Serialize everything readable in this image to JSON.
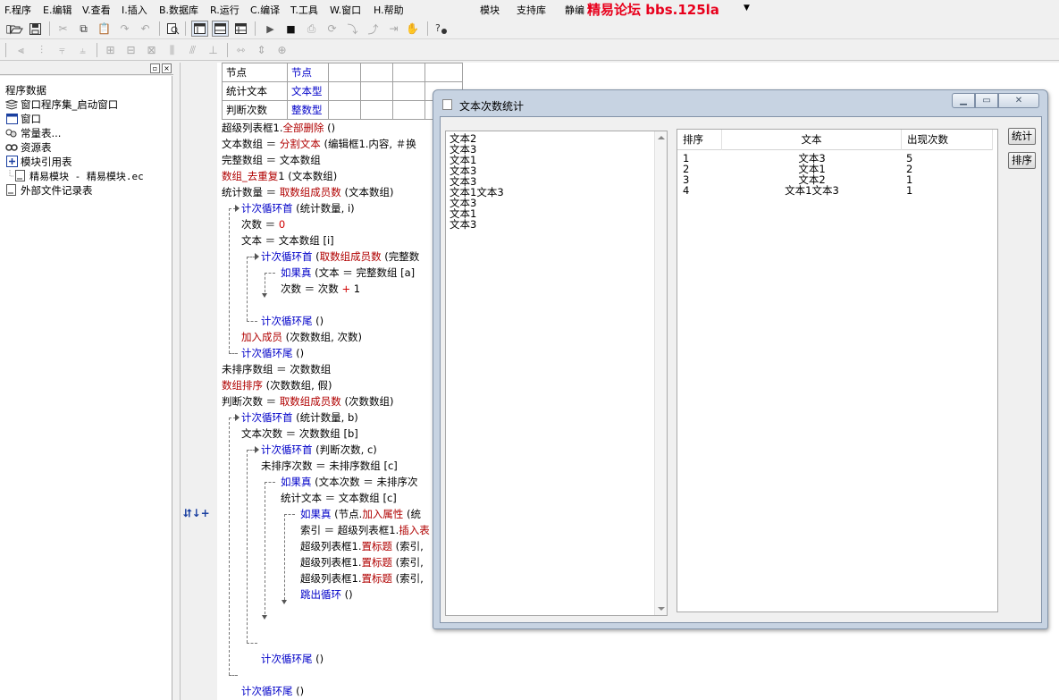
{
  "menubar": {
    "items": [
      "F.程序",
      "E.编辑",
      "V.查看",
      "I.插入",
      "B.数据库",
      "R.运行",
      "C.编译",
      "T.工具",
      "W.窗口",
      "H.帮助"
    ],
    "extra": [
      "模块",
      "支持库",
      "静编"
    ],
    "watermark": "精易论坛 bbs.125la"
  },
  "toolbar": {
    "icons": [
      "open-icon",
      "save-icon",
      "cut-icon",
      "copy-icon",
      "paste-icon",
      "redo-icon",
      "undo-icon",
      "find-icon",
      "layout-1-icon",
      "layout-2-icon",
      "layout-3-icon",
      "run-icon",
      "stop-icon",
      "step-icon",
      "step-into-icon",
      "step-over-icon",
      "step-out-icon",
      "run-to-icon",
      "hand-icon",
      "help-icon"
    ]
  },
  "left_panel": {
    "tree": [
      {
        "label": "程序数据",
        "icon": "",
        "indent": 0
      },
      {
        "label": "窗口程序集_启动窗口",
        "icon": "assembly-icon",
        "indent": 0
      },
      {
        "label": "窗口",
        "icon": "window-icon",
        "indent": 0
      },
      {
        "label": "常量表...",
        "icon": "constant-icon",
        "indent": 0
      },
      {
        "label": "资源表",
        "icon": "resource-icon",
        "indent": 0
      },
      {
        "label": "模块引用表",
        "icon": "module-icon",
        "indent": 0
      },
      {
        "label": "精易模块 - 精易模块.ec",
        "icon": "file-icon",
        "indent": 1
      },
      {
        "label": "外部文件记录表",
        "icon": "file-icon",
        "indent": 0
      }
    ]
  },
  "gutter": {
    "icons": "⮃↓+"
  },
  "editor": {
    "var_table": [
      [
        "节点",
        "节点"
      ],
      [
        "统计文本",
        "文本型"
      ],
      [
        "判断次数",
        "整数型"
      ]
    ],
    "lines": [
      {
        "indent": 0,
        "parts": [
          [
            "超级列表框1.",
            ""
          ],
          [
            "全部删除",
            "r"
          ],
          [
            " ()",
            ""
          ]
        ]
      },
      {
        "indent": 0,
        "parts": [
          [
            "文本数组 ＝ ",
            ""
          ],
          [
            "分割文本",
            "r"
          ],
          [
            " (编辑框1.内容, ＃换",
            ""
          ]
        ]
      },
      {
        "indent": 0,
        "parts": [
          [
            "完整数组 ＝ 文本数组",
            ""
          ]
        ]
      },
      {
        "indent": 0,
        "parts": [
          [
            "数组_去重复",
            "r"
          ],
          [
            "1 (文本数组)",
            ""
          ]
        ]
      },
      {
        "indent": 0,
        "parts": [
          [
            "统计数量 ＝ ",
            ""
          ],
          [
            "取数组成员数",
            "r"
          ],
          [
            " (文本数组)",
            ""
          ]
        ]
      },
      {
        "indent": 1,
        "parts": [
          [
            "计次循环首",
            "b"
          ],
          [
            " (统计数量, i)",
            ""
          ]
        ]
      },
      {
        "indent": 1,
        "parts": [
          [
            "次数 ＝ ",
            ""
          ],
          [
            "0",
            "n"
          ]
        ]
      },
      {
        "indent": 1,
        "parts": [
          [
            "文本 ＝ 文本数组 [i]",
            ""
          ]
        ]
      },
      {
        "indent": 2,
        "parts": [
          [
            "计次循环首",
            "b"
          ],
          [
            " (",
            ""
          ],
          [
            "取数组成员数",
            "r"
          ],
          [
            " (完整数",
            ""
          ]
        ]
      },
      {
        "indent": 3,
        "parts": [
          [
            "如果真",
            "b"
          ],
          [
            " (文本 ＝ 完整数组 [a]",
            ""
          ]
        ]
      },
      {
        "indent": 3,
        "parts": [
          [
            "次数 ＝ 次数 ",
            ""
          ],
          [
            "+",
            "n"
          ],
          [
            " 1",
            ""
          ]
        ]
      },
      {
        "indent": 3,
        "parts": [
          [
            "",
            ""
          ]
        ]
      },
      {
        "indent": 2,
        "parts": [
          [
            "计次循环尾",
            "b"
          ],
          [
            " ()",
            ""
          ]
        ]
      },
      {
        "indent": 1,
        "parts": [
          [
            "加入成员",
            "r"
          ],
          [
            " (次数数组, 次数)",
            ""
          ]
        ]
      },
      {
        "indent": 1,
        "parts": [
          [
            "计次循环尾",
            "b"
          ],
          [
            " ()",
            ""
          ]
        ]
      },
      {
        "indent": 0,
        "parts": [
          [
            "未排序数组 ＝ 次数数组",
            ""
          ]
        ]
      },
      {
        "indent": 0,
        "parts": [
          [
            "数组排序",
            "r"
          ],
          [
            " (次数数组, 假)",
            ""
          ]
        ]
      },
      {
        "indent": 0,
        "parts": [
          [
            "判断次数 ＝ ",
            ""
          ],
          [
            "取数组成员数",
            "r"
          ],
          [
            " (次数数组)",
            ""
          ]
        ]
      },
      {
        "indent": 1,
        "parts": [
          [
            "计次循环首",
            "b"
          ],
          [
            " (统计数量, b)",
            ""
          ]
        ]
      },
      {
        "indent": 1,
        "parts": [
          [
            "文本次数 ＝ 次数数组 [b]",
            ""
          ]
        ]
      },
      {
        "indent": 2,
        "parts": [
          [
            "计次循环首",
            "b"
          ],
          [
            " (判断次数, c)",
            ""
          ]
        ]
      },
      {
        "indent": 2,
        "parts": [
          [
            "未排序次数 ＝ 未排序数组 [c]",
            ""
          ]
        ]
      },
      {
        "indent": 3,
        "parts": [
          [
            "如果真",
            "b"
          ],
          [
            " (文本次数 ＝ 未排序次",
            ""
          ]
        ]
      },
      {
        "indent": 3,
        "parts": [
          [
            "统计文本 ＝ 文本数组 [c]",
            ""
          ]
        ]
      },
      {
        "indent": 4,
        "parts": [
          [
            "如果真",
            "b"
          ],
          [
            " (节点.",
            ""
          ],
          [
            "加入属性",
            "r"
          ],
          [
            " (统",
            ""
          ]
        ]
      },
      {
        "indent": 4,
        "parts": [
          [
            "索引 ＝ 超级列表框1.",
            ""
          ],
          [
            "插入表",
            "r"
          ]
        ]
      },
      {
        "indent": 4,
        "parts": [
          [
            "超级列表框1.",
            ""
          ],
          [
            "置标题",
            "r"
          ],
          [
            " (索引,",
            ""
          ]
        ]
      },
      {
        "indent": 4,
        "parts": [
          [
            "超级列表框1.",
            ""
          ],
          [
            "置标题",
            "r"
          ],
          [
            " (索引,",
            ""
          ]
        ]
      },
      {
        "indent": 4,
        "parts": [
          [
            "超级列表框1.",
            ""
          ],
          [
            "置标题",
            "r"
          ],
          [
            " (索引,",
            ""
          ]
        ]
      },
      {
        "indent": 4,
        "parts": [
          [
            "跳出循环",
            "b"
          ],
          [
            " ()",
            ""
          ]
        ]
      },
      {
        "indent": 4,
        "parts": [
          [
            "",
            ""
          ]
        ]
      },
      {
        "indent": 3,
        "parts": [
          [
            "",
            ""
          ]
        ]
      },
      {
        "indent": 2,
        "parts": [
          [
            "",
            ""
          ]
        ]
      },
      {
        "indent": 2,
        "parts": [
          [
            "计次循环尾",
            "b"
          ],
          [
            " ()",
            ""
          ]
        ]
      },
      {
        "indent": 1,
        "parts": [
          [
            "",
            ""
          ]
        ]
      },
      {
        "indent": 1,
        "parts": [
          [
            "计次循环尾",
            "b"
          ],
          [
            " ()",
            ""
          ]
        ]
      }
    ]
  },
  "dialog": {
    "title": "文本次数统计",
    "text_lines": [
      "文本2",
      "文本3",
      "文本1",
      "文本3",
      "文本3",
      "文本1文本3",
      "文本3",
      "文本1",
      "文本3"
    ],
    "list": {
      "columns": [
        "排序",
        "文本",
        "出现次数"
      ],
      "rows": [
        [
          "1",
          "文本3",
          "5"
        ],
        [
          "2",
          "文本1",
          "2"
        ],
        [
          "3",
          "文本2",
          "1"
        ],
        [
          "4",
          "文本1文本3",
          "1"
        ]
      ]
    },
    "buttons": {
      "stat": "统计",
      "sort": "排序"
    }
  }
}
